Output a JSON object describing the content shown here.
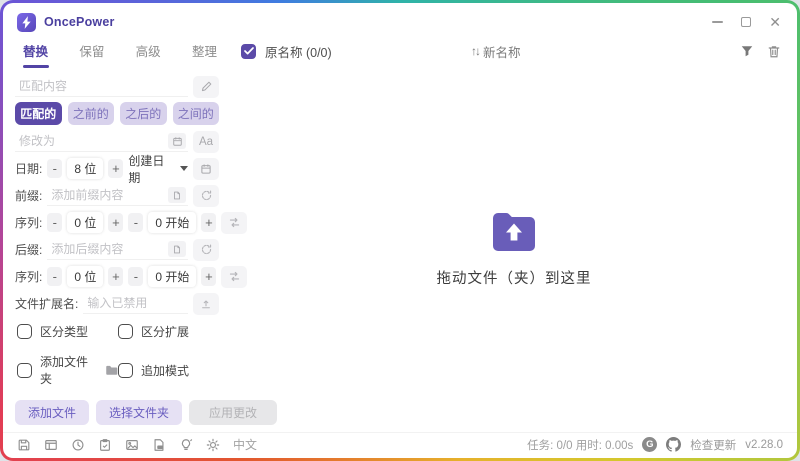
{
  "app": {
    "title": "OncePower"
  },
  "tabs": [
    {
      "label": "替换",
      "active": true
    },
    {
      "label": "保留",
      "active": false
    },
    {
      "label": "高级",
      "active": false
    },
    {
      "label": "整理",
      "active": false
    }
  ],
  "panel": {
    "match": {
      "placeholder": "匹配内容"
    },
    "modes": [
      {
        "label": "匹配的",
        "active": true
      },
      {
        "label": "之前的",
        "active": false
      },
      {
        "label": "之后的",
        "active": false
      },
      {
        "label": "之间的",
        "active": false
      }
    ],
    "replace": {
      "placeholder": "修改为"
    },
    "case_button": "Aa",
    "stepper": {
      "minus": "-",
      "plus": "+"
    },
    "date": {
      "label": "日期:",
      "digits": "8 位",
      "source": "创建日期"
    },
    "prefix": {
      "label": "前缀:",
      "placeholder": "添加前缀内容"
    },
    "prefix_seq": {
      "label": "序列:",
      "digits": "0 位",
      "start": "0 开始"
    },
    "suffix": {
      "label": "后缀:",
      "placeholder": "添加后缀内容"
    },
    "suffix_seq": {
      "label": "序列:",
      "digits": "0 位",
      "start": "0 开始"
    },
    "extension": {
      "label": "文件扩展名:",
      "placeholder": "输入已禁用"
    },
    "options": [
      {
        "label": "区分类型",
        "checked": false
      },
      {
        "label": "区分扩展",
        "checked": false
      },
      {
        "label": "添加文件夹",
        "checked": false,
        "folder_icon": true
      },
      {
        "label": "追加模式",
        "checked": false
      }
    ],
    "actions": {
      "add_files": "添加文件",
      "choose_folder": "选择文件夹",
      "apply": "应用更改"
    }
  },
  "list": {
    "select_all_checked": true,
    "original_header": "原名称 (0/0)",
    "sort_glyph": "↑↓",
    "new_header": "新名称",
    "dropzone": "拖动文件（夹）到这里"
  },
  "statusbar": {
    "icons": [
      "save",
      "layout",
      "history",
      "clipboard",
      "image",
      "file-info",
      "lamp",
      "theme-sun"
    ],
    "language": "中文",
    "task_info": "任务: 0/0 用时: 0.00s",
    "links": [
      "gitee",
      "github"
    ],
    "check_update": "检查更新",
    "version": "v2.28.0"
  },
  "colors": {
    "primary": "#5b4aa8",
    "primary_light_bg": "#d8d2ec",
    "primary_light_text": "#7d72bb",
    "folder_accent": "#695db9",
    "disabled_bg": "#e7e7e9",
    "disabled_text": "#b3b3b6"
  }
}
